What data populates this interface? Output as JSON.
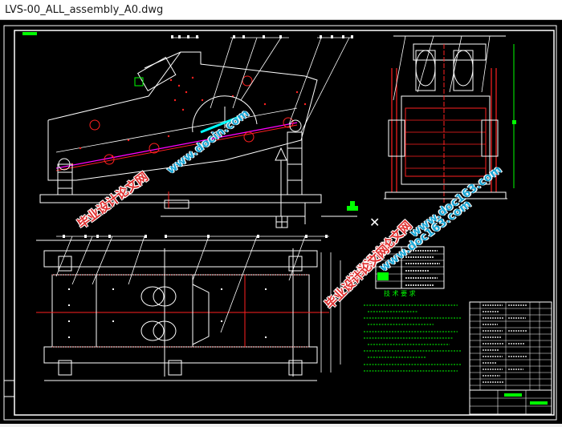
{
  "window": {
    "title": "LVS-00_ALL_assembly_A0.dwg"
  },
  "drawing": {
    "notes_title": "技 术 要 求",
    "watermarks": [
      {
        "id": "wm1",
        "text": "www.docin.com"
      },
      {
        "id": "wm2",
        "text": "www.doc163.com"
      },
      {
        "id": "wm3",
        "text": "www.doc163.com"
      }
    ],
    "cn_watermarks": [
      {
        "id": "cn1",
        "text": "毕业设计论文网"
      },
      {
        "id": "cn2",
        "text": "毕业设计论文网"
      },
      {
        "id": "cn3",
        "text": "毕业设计论文网"
      }
    ],
    "colors": {
      "background": "#000000",
      "frame": "#ffffff",
      "red": "#ff2020",
      "green": "#00ff00",
      "magenta": "#ff00ff",
      "cyan": "#00ffff"
    }
  }
}
